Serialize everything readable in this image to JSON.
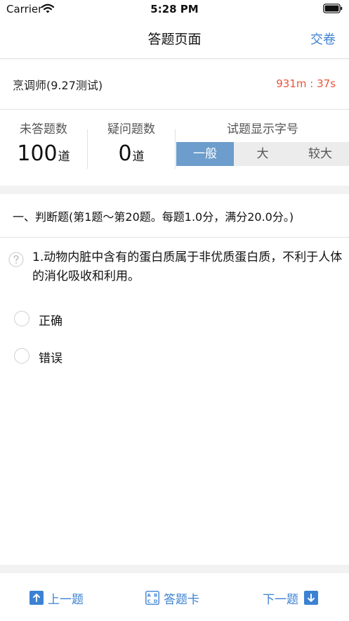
{
  "status_bar": {
    "carrier": "Carrier",
    "time": "5:28 PM"
  },
  "nav": {
    "title": "答题页面",
    "submit_label": "交卷"
  },
  "exam": {
    "name": "烹调师(9.27测试)",
    "timer": "931m : 37s"
  },
  "stats": {
    "unanswered_label": "未答题数",
    "unanswered_count": "100",
    "unanswered_unit": "道",
    "doubtful_label": "疑问题数",
    "doubtful_count": "0",
    "doubtful_unit": "道",
    "font_size_label": "试题显示字号",
    "font_size_options": [
      "一般",
      "大",
      "较大"
    ],
    "font_size_selected": "一般"
  },
  "section": {
    "title": "一、判断题(第1题～第20题。每题1.0分，满分20.0分。)"
  },
  "question": {
    "text": "1.动物内脏中含有的蛋白质属于非优质蛋白质，不利于人体的消化吸收和利用。",
    "options": [
      "正确",
      "错误"
    ]
  },
  "bottom_bar": {
    "prev_label": "上一题",
    "answer_card_label": "答题卡",
    "next_label": "下一题"
  },
  "colors": {
    "accent": "#3c82d2",
    "timer": "#e8543b",
    "segment_active": "#6c9dcc"
  },
  "icons": [
    "wifi-icon",
    "battery-icon",
    "help-circle-icon",
    "radio-icon",
    "arrow-up-icon",
    "answer-card-icon",
    "arrow-down-icon"
  ]
}
